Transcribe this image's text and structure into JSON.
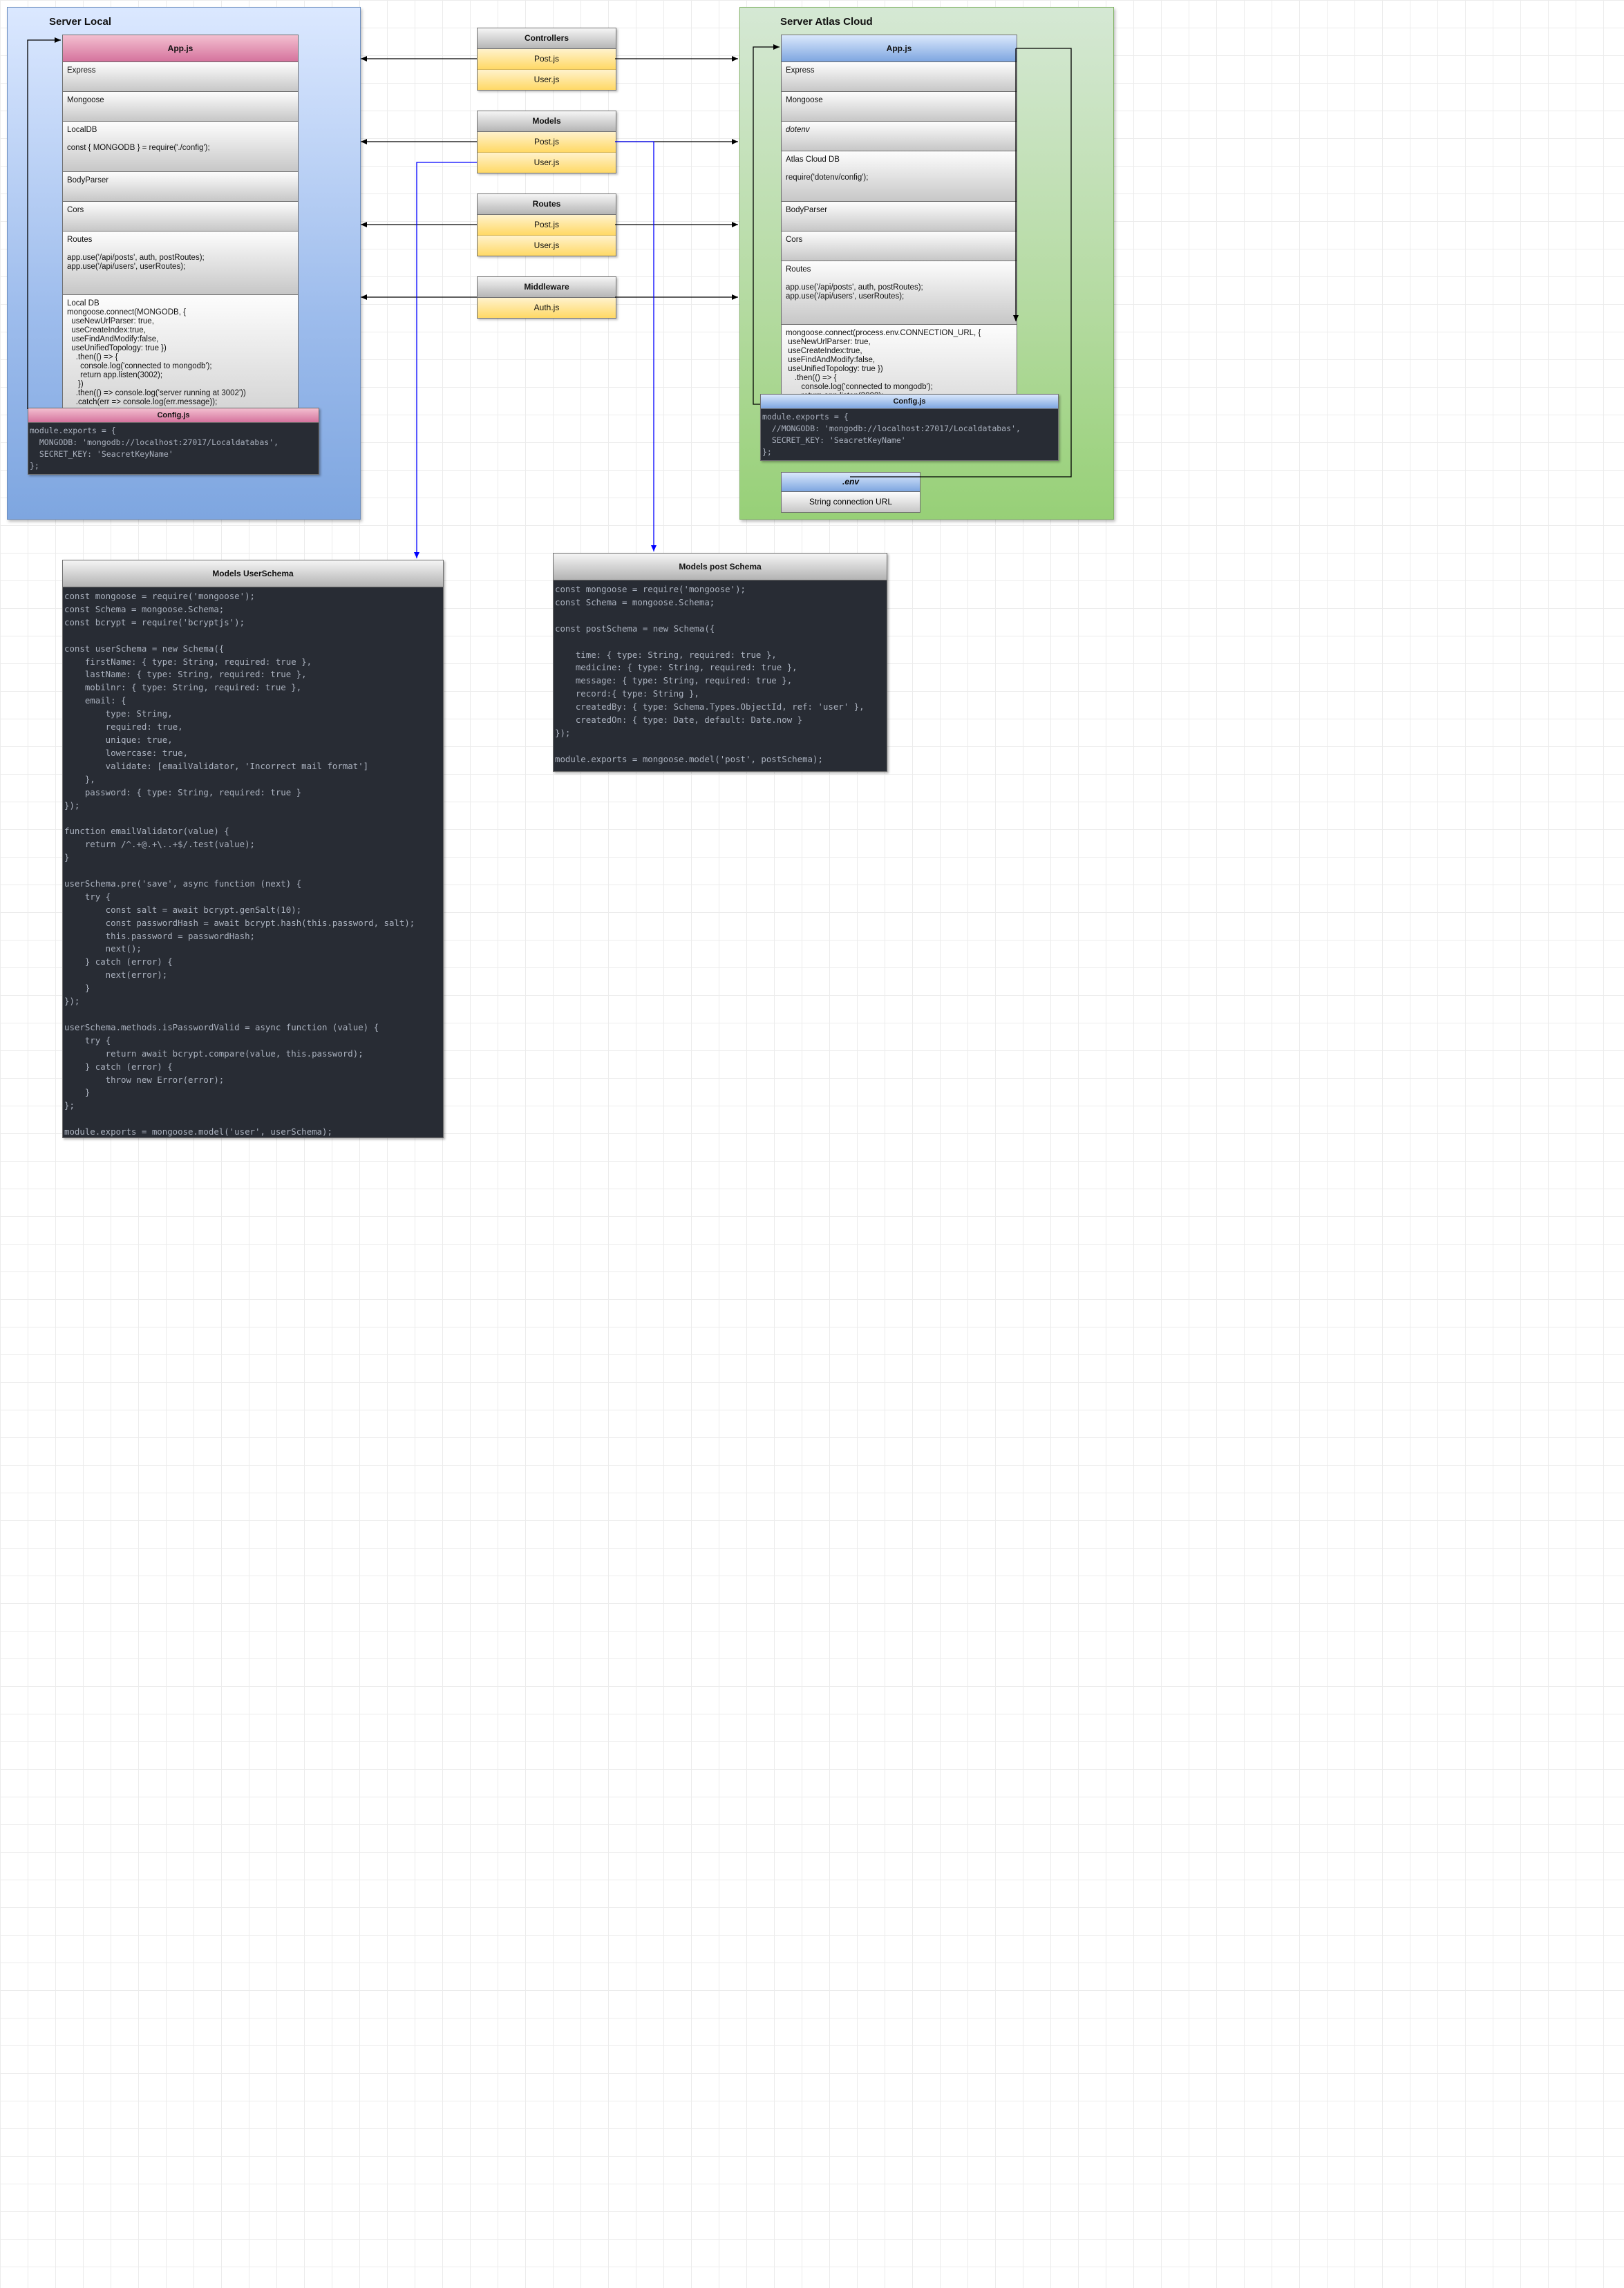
{
  "server_local": {
    "title": "Server Local",
    "app": {
      "title": "App.js",
      "rows": [
        "Express",
        "Mongoose",
        "LocalDB\n\nconst { MONGODB } = require('./config');",
        "BodyParser",
        "Cors",
        "Routes\n\napp.use('/api/posts', auth, postRoutes);\napp.use('/api/users', userRoutes);",
        "Local DB\nmongoose.connect(MONGODB, {\n  useNewUrlParser: true,\n  useCreateIndex:true,\n  useFindAndModify:false,\n  useUnifiedTopology: true })\n    .then(() => {\n      console.log('connected to mongodb');\n      return app.listen(3002);\n     })\n    .then(() => console.log('server running at 3002'))\n    .catch(err => console.log(err.message));"
      ]
    },
    "config": {
      "title": "Config.js",
      "code": "module.exports = {\n  MONGODB: 'mongodb://localhost:27017/Localdatabas',\n  SECRET_KEY: 'SeacretKeyName'\n};"
    }
  },
  "server_cloud": {
    "title": "Server Atlas Cloud",
    "app": {
      "title": "App.js",
      "rows": [
        "Express",
        "Mongoose",
        "dotenv",
        "Atlas Cloud DB\n\nrequire('dotenv/config');",
        "BodyParser",
        "Cors",
        "Routes\n\napp.use('/api/posts', auth, postRoutes);\napp.use('/api/users', userRoutes);",
        "mongoose.connect(process.env.CONNECTION_URL, {\n useNewUrlParser: true,\n useCreateIndex:true,\n useFindAndModify:false,\n useUnifiedTopology: true })\n    .then(() => {\n       console.log('connected to mongodb');\n       return app.listen(3002);\n     })\n    .then(() => console.log('server running at 3002'))\n    .catch(err => console.log(err.message));"
      ]
    },
    "config": {
      "title": "Config.js",
      "code": "module.exports = {\n  //MONGODB: 'mongodb://localhost:27017/Localdatabas',\n  SECRET_KEY: 'SeacretKeyName'\n};"
    },
    "env": {
      "title": ".env",
      "row": "String connection URL"
    }
  },
  "modules": [
    {
      "title": "Controllers",
      "items": [
        "Post.js",
        "User.js"
      ]
    },
    {
      "title": "Models",
      "items": [
        "Post.js",
        "User.js"
      ]
    },
    {
      "title": "Routes",
      "items": [
        "Post.js",
        "User.js"
      ]
    },
    {
      "title": "Middleware",
      "items": [
        "Auth.js"
      ]
    }
  ],
  "user_schema": {
    "title": "Models UserSchema",
    "code": "const mongoose = require('mongoose');\nconst Schema = mongoose.Schema;\nconst bcrypt = require('bcryptjs');\n\nconst userSchema = new Schema({\n    firstName: { type: String, required: true },\n    lastName: { type: String, required: true },\n    mobilnr: { type: String, required: true },\n    email: {\n        type: String,\n        required: true,\n        unique: true,\n        lowercase: true,\n        validate: [emailValidator, 'Incorrect mail format']\n    },\n    password: { type: String, required: true }\n});\n\nfunction emailValidator(value) {\n    return /^.+@.+\\..+$/.test(value);\n}\n\nuserSchema.pre('save', async function (next) {\n    try {\n        const salt = await bcrypt.genSalt(10);\n        const passwordHash = await bcrypt.hash(this.password, salt);\n        this.password = passwordHash;\n        next();\n    } catch (error) {\n        next(error);\n    }\n});\n\nuserSchema.methods.isPasswordValid = async function (value) {\n    try {\n        return await bcrypt.compare(value, this.password);\n    } catch (error) {\n        throw new Error(error);\n    }\n};\n\nmodule.exports = mongoose.model('user', userSchema);"
  },
  "post_schema": {
    "title": "Models post Schema",
    "code": "const mongoose = require('mongoose');\nconst Schema = mongoose.Schema;\n\nconst postSchema = new Schema({\n\n    time: { type: String, required: true },\n    medicine: { type: String, required: true },\n    message: { type: String, required: true },\n    record:{ type: String },\n    createdBy: { type: Schema.Types.ObjectId, ref: 'user' },\n    createdOn: { type: Date, default: Date.now }\n});\n\nmodule.exports = mongoose.model('post', postSchema);"
  },
  "colors": {
    "local_fill": "#7ea6e0",
    "cloud_fill": "#97d077",
    "local_app_header": "#d5739d",
    "cloud_app_header": "#7ea6e0",
    "module_item": "#ffd966",
    "code_bg": "#282c34",
    "connector_black": "#000000",
    "connector_blue": "#0000ff"
  }
}
